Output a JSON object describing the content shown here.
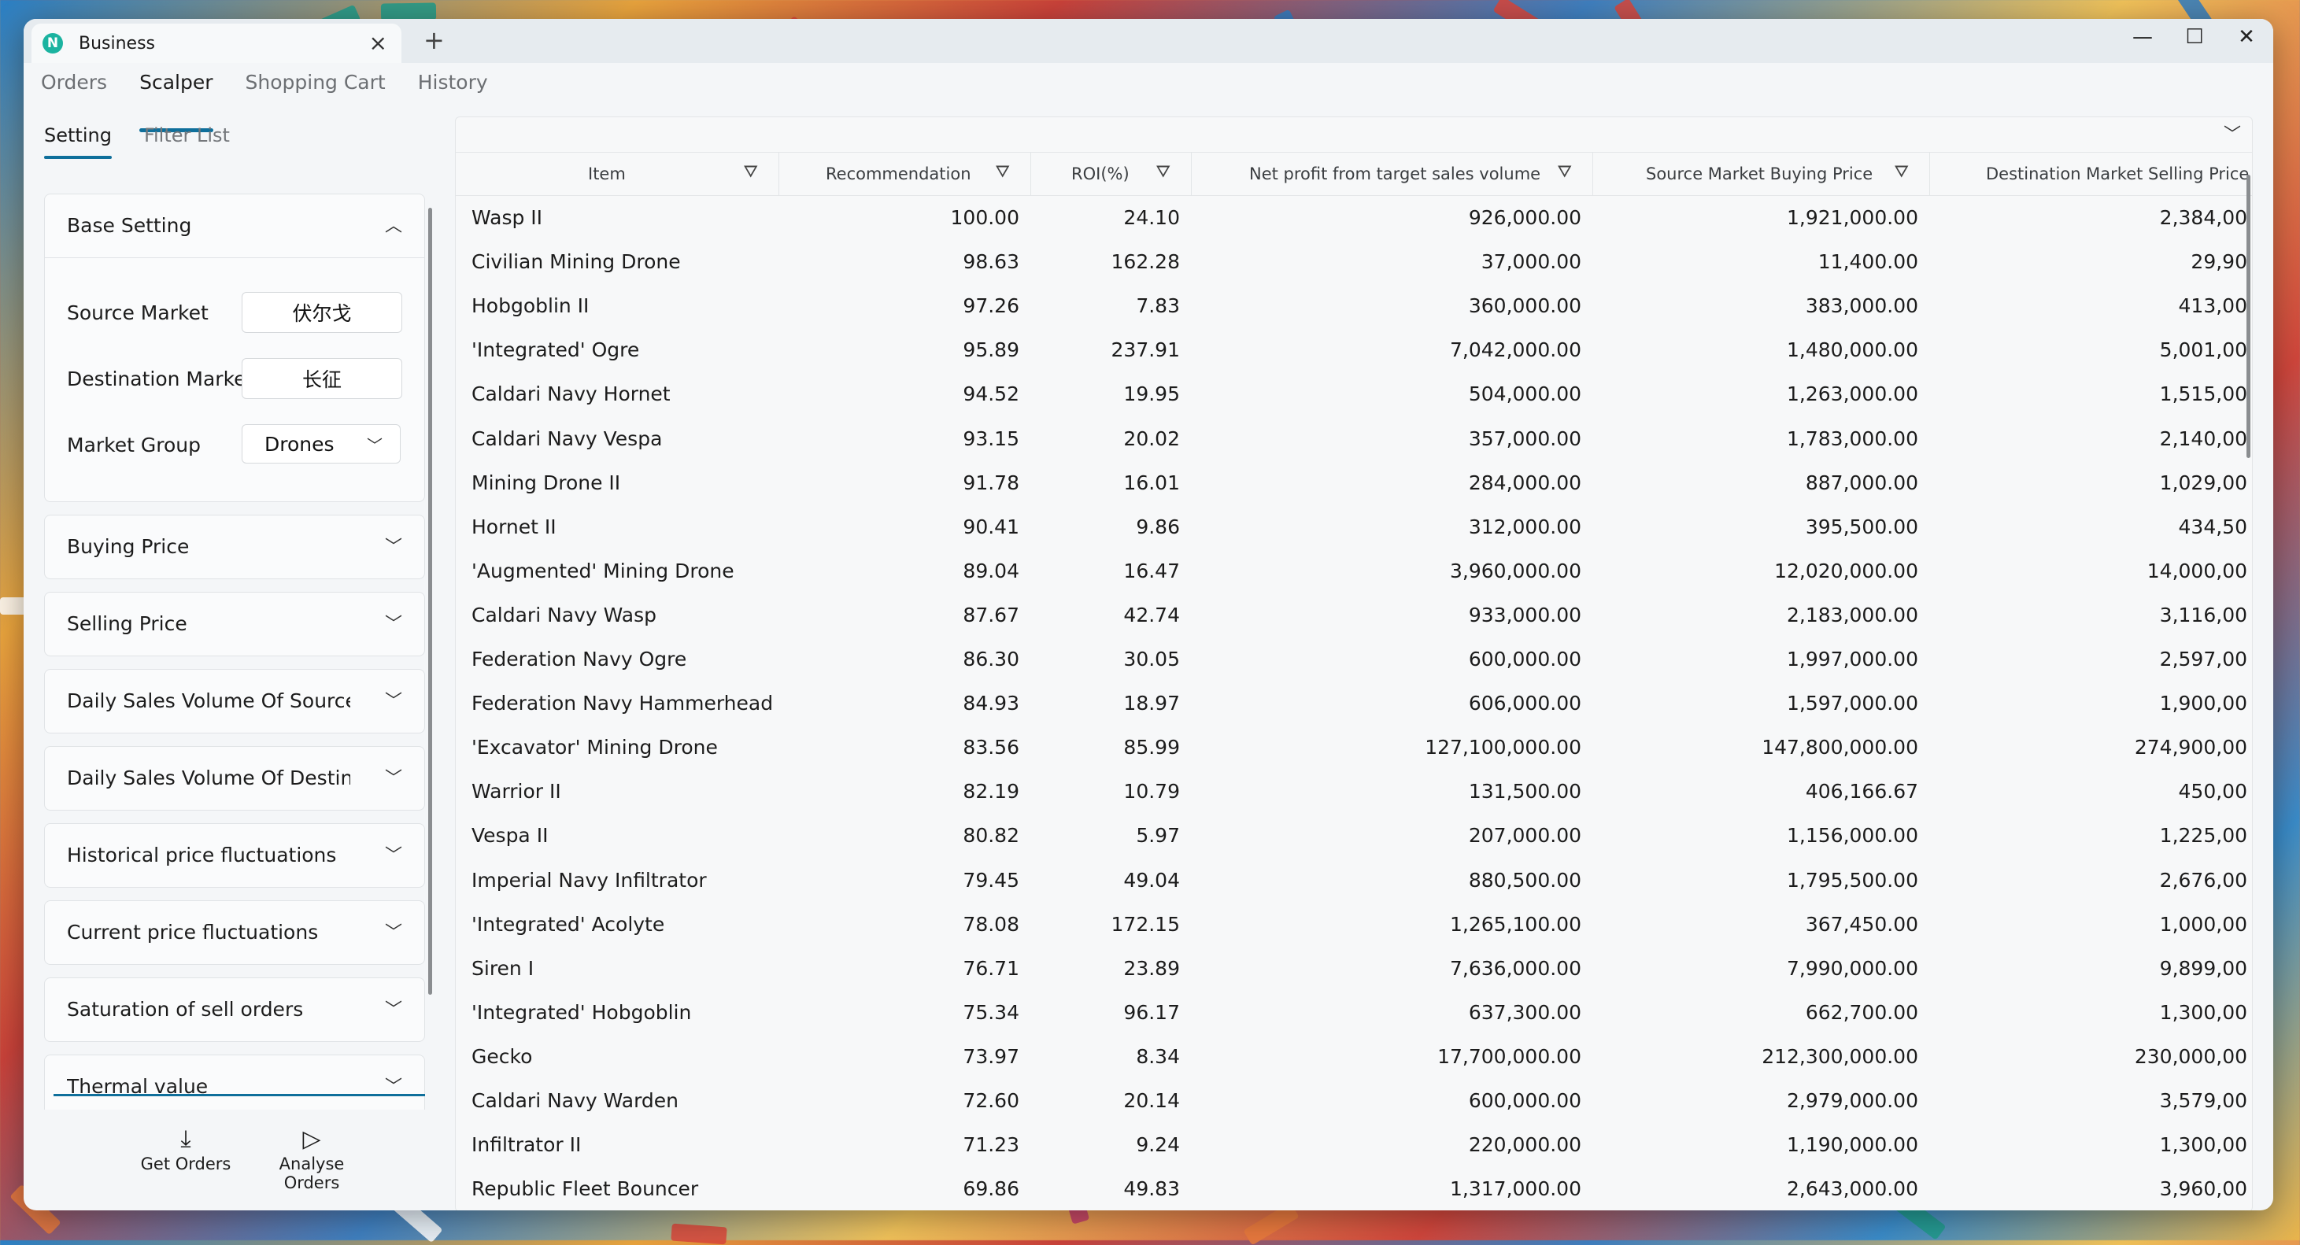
{
  "window": {
    "tab_title": "Business",
    "app_logo": "N",
    "new_tab": "+",
    "controls": {
      "minimize": "—",
      "maximize": "☐",
      "close": "✕"
    }
  },
  "nav": {
    "tabs": [
      "Orders",
      "Scalper",
      "Shopping Cart",
      "History"
    ],
    "active_tab": "Scalper",
    "subtabs": [
      "Setting",
      "Filter List"
    ],
    "active_subtab": "Setting"
  },
  "settings": {
    "base_setting": {
      "title": "Base Setting",
      "source_market_label": "Source Market",
      "source_market_value": "伏尔戈",
      "destination_market_label": "Destination Market",
      "destination_market_value": "长征",
      "market_group_label": "Market Group",
      "market_group_value": "Drones"
    },
    "sections": [
      "Buying Price",
      "Selling Price",
      "Daily Sales Volume Of Source Ma",
      "Daily Sales Volume Of Destinatic",
      "Historical price fluctuations",
      "Current price fluctuations",
      "Saturation of sell orders",
      "Thermal value"
    ],
    "actions": {
      "get_orders": "Get Orders",
      "analyse_orders_1": "Analyse",
      "analyse_orders_2": "Orders"
    }
  },
  "table": {
    "columns": [
      "Item",
      "Recommendation",
      "ROI(%)",
      "Net profit from target sales volume",
      "Source Market Buying Price",
      "Destination Market Selling Price"
    ],
    "rows": [
      [
        "Wasp II",
        "100.00",
        "24.10",
        "926,000.00",
        "1,921,000.00",
        "2,384,00"
      ],
      [
        "Civilian Mining Drone",
        "98.63",
        "162.28",
        "37,000.00",
        "11,400.00",
        "29,90"
      ],
      [
        "Hobgoblin II",
        "97.26",
        "7.83",
        "360,000.00",
        "383,000.00",
        "413,00"
      ],
      [
        "'Integrated' Ogre",
        "95.89",
        "237.91",
        "7,042,000.00",
        "1,480,000.00",
        "5,001,00"
      ],
      [
        "Caldari Navy Hornet",
        "94.52",
        "19.95",
        "504,000.00",
        "1,263,000.00",
        "1,515,00"
      ],
      [
        "Caldari Navy Vespa",
        "93.15",
        "20.02",
        "357,000.00",
        "1,783,000.00",
        "2,140,00"
      ],
      [
        "Mining Drone II",
        "91.78",
        "16.01",
        "284,000.00",
        "887,000.00",
        "1,029,00"
      ],
      [
        "Hornet II",
        "90.41",
        "9.86",
        "312,000.00",
        "395,500.00",
        "434,50"
      ],
      [
        "'Augmented' Mining Drone",
        "89.04",
        "16.47",
        "3,960,000.00",
        "12,020,000.00",
        "14,000,00"
      ],
      [
        "Caldari Navy Wasp",
        "87.67",
        "42.74",
        "933,000.00",
        "2,183,000.00",
        "3,116,00"
      ],
      [
        "Federation Navy Ogre",
        "86.30",
        "30.05",
        "600,000.00",
        "1,997,000.00",
        "2,597,00"
      ],
      [
        "Federation Navy Hammerhead",
        "84.93",
        "18.97",
        "606,000.00",
        "1,597,000.00",
        "1,900,00"
      ],
      [
        "'Excavator' Mining Drone",
        "83.56",
        "85.99",
        "127,100,000.00",
        "147,800,000.00",
        "274,900,00"
      ],
      [
        "Warrior II",
        "82.19",
        "10.79",
        "131,500.00",
        "406,166.67",
        "450,00"
      ],
      [
        "Vespa II",
        "80.82",
        "5.97",
        "207,000.00",
        "1,156,000.00",
        "1,225,00"
      ],
      [
        "Imperial Navy Infiltrator",
        "79.45",
        "49.04",
        "880,500.00",
        "1,795,500.00",
        "2,676,00"
      ],
      [
        "'Integrated' Acolyte",
        "78.08",
        "172.15",
        "1,265,100.00",
        "367,450.00",
        "1,000,00"
      ],
      [
        "Siren I",
        "76.71",
        "23.89",
        "7,636,000.00",
        "7,990,000.00",
        "9,899,00"
      ],
      [
        "'Integrated' Hobgoblin",
        "75.34",
        "96.17",
        "637,300.00",
        "662,700.00",
        "1,300,00"
      ],
      [
        "Gecko",
        "73.97",
        "8.34",
        "17,700,000.00",
        "212,300,000.00",
        "230,000,00"
      ],
      [
        "Caldari Navy Warden",
        "72.60",
        "20.14",
        "600,000.00",
        "2,979,000.00",
        "3,579,00"
      ],
      [
        "Infiltrator II",
        "71.23",
        "9.24",
        "220,000.00",
        "1,190,000.00",
        "1,300,00"
      ],
      [
        "Republic Fleet Bouncer",
        "69.86",
        "49.83",
        "1,317,000.00",
        "2,643,000.00",
        "3,960,00"
      ]
    ]
  },
  "icons": {
    "filter": "filter-icon",
    "chevron_up": "chevron-up-icon",
    "chevron_down": "chevron-down-icon",
    "download": "download-icon",
    "play": "play-icon"
  },
  "colors": {
    "accent": "#0f6f9b",
    "logo": "#1bb3a0"
  }
}
